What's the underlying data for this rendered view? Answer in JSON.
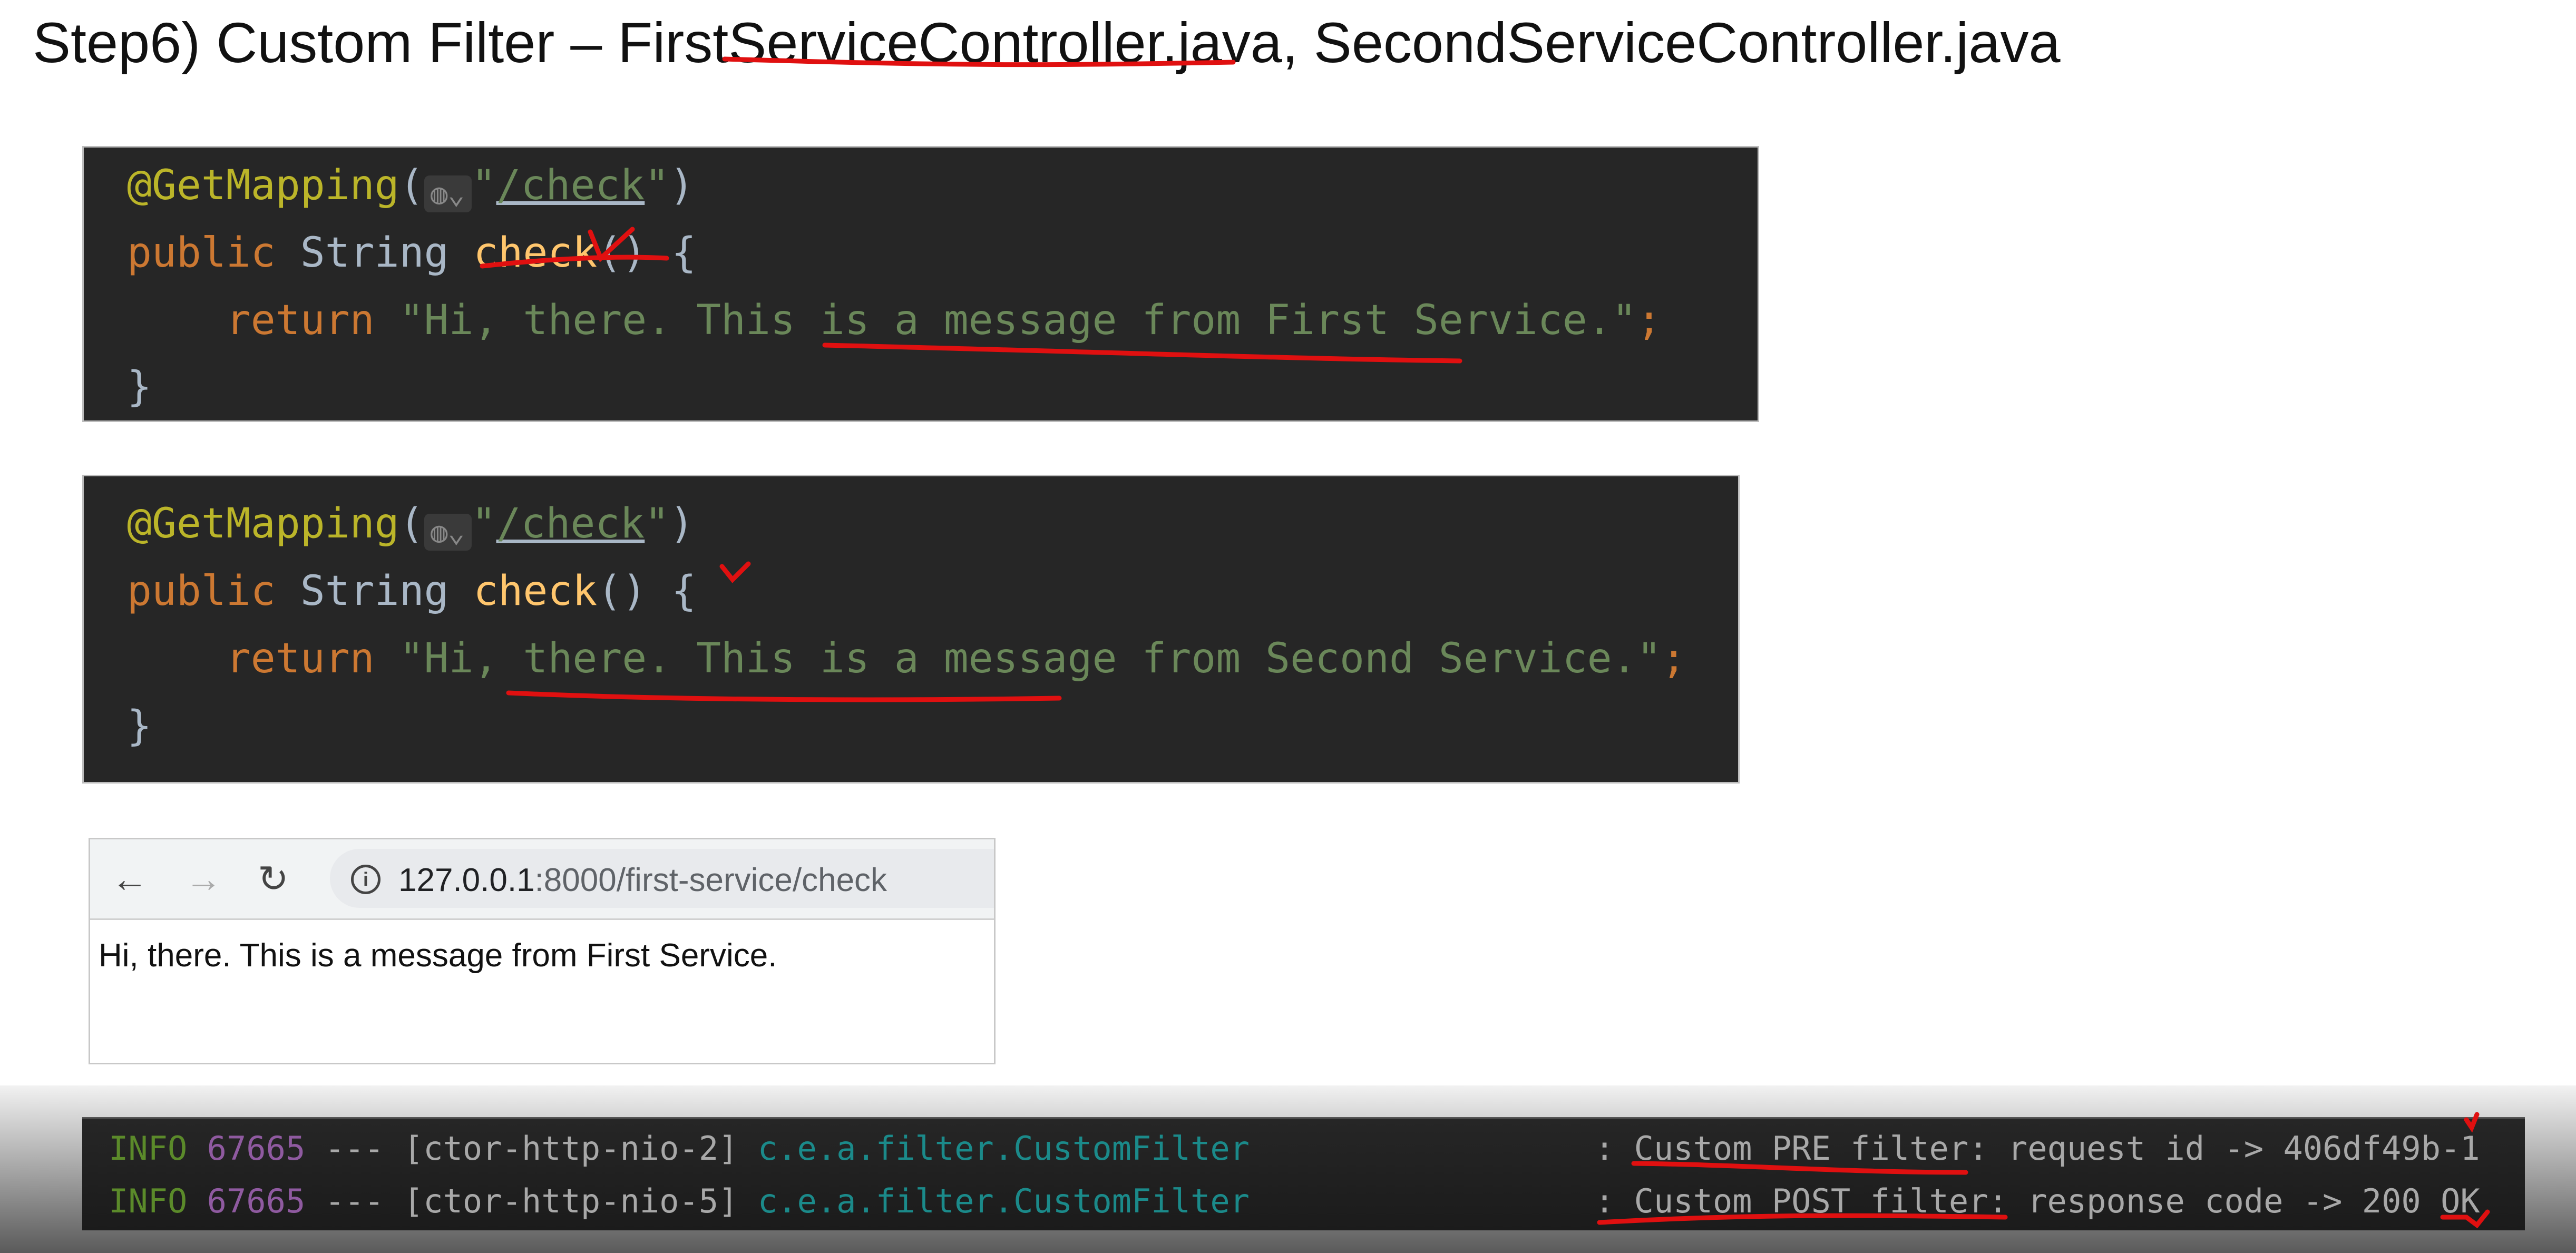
{
  "title": "Step6) Custom Filter – FirstServiceController.java, SecondServiceController.java",
  "code_blocks": [
    {
      "annotation": "@GetMapping",
      "open": "(",
      "path": "/check",
      "close": ")",
      "kw_public": "public",
      "type": "String",
      "method": "check",
      "sig_tail": "() {",
      "kw_return": "return",
      "string": "\"Hi, there. This is a message from First Service.\"",
      "semi": ";",
      "end": "}"
    },
    {
      "annotation": "@GetMapping",
      "open": "(",
      "path": "/check",
      "close": ")",
      "kw_public": "public",
      "type": "String",
      "method": "check",
      "sig_tail": "() {",
      "kw_return": "return",
      "string": "\"Hi, there. This is a message from Second Service.\"",
      "semi": ";",
      "end": "}"
    }
  ],
  "browser": {
    "url_host": "127.0.0.1",
    "url_rest": ":8000/first-service/check",
    "content": "Hi, there. This is a message from First Service.",
    "icons": [
      "back-arrow-icon",
      "forward-arrow-icon",
      "reload-icon",
      "info-icon"
    ]
  },
  "log": [
    {
      "level": "INFO",
      "pid": "67665",
      "sep": "---",
      "thread": "[ctor-http-nio-2]",
      "logger": "c.e.a.filter.CustomFilter",
      "message": ": Custom PRE filter: request id -> 406df49b-1"
    },
    {
      "level": "INFO",
      "pid": "67665",
      "sep": "---",
      "thread": "[ctor-http-nio-5]",
      "logger": "c.e.a.filter.CustomFilter",
      "message": ": Custom POST filter: response code -> 200 OK"
    }
  ],
  "colors": {
    "annotation": "#bbb529",
    "keyword": "#cc7832",
    "function": "#ffc66d",
    "string": "#6a8759",
    "ink": "#e01010"
  }
}
